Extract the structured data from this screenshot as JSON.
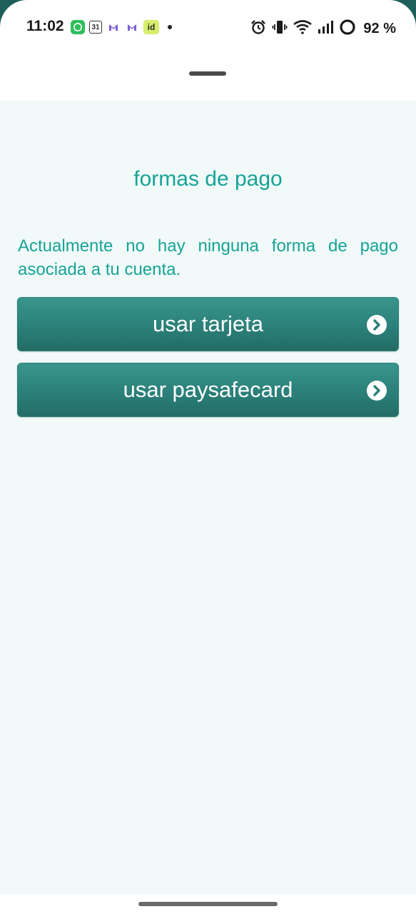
{
  "status_bar": {
    "time": "11:02",
    "notification_icons": [
      "whatsapp-icon",
      "calendar-icon",
      "mail-icon",
      "mail-icon",
      "id-app-icon",
      "more-dot-icon"
    ],
    "calendar_day": "31",
    "id_app_label": "id",
    "system_icons": [
      "alarm-icon",
      "vibrate-icon",
      "wifi-icon",
      "signal-icon",
      "battery-ring-icon"
    ],
    "battery": "92 %"
  },
  "sheet": {
    "title": "formas de pago",
    "message": "Actualmente no hay ninguna forma de pago asociada a tu cuenta.",
    "buttons": [
      {
        "label": "usar tarjeta",
        "icon": "chevron-right-icon"
      },
      {
        "label": "usar paysafecard",
        "icon": "chevron-right-icon"
      }
    ]
  },
  "colors": {
    "accent": "#17a398",
    "button": "#2b8079",
    "background": "#f1faf9"
  }
}
